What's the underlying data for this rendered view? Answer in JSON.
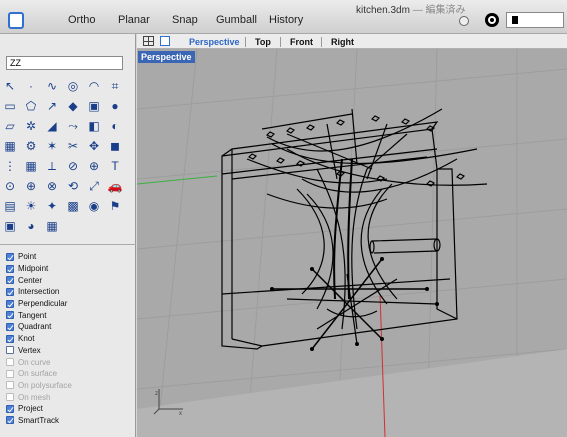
{
  "window": {
    "title": "kitchen.3dm",
    "title_sep": " — ",
    "title_status": "編集済み"
  },
  "toolbar": {
    "ortho": "Ortho",
    "planar": "Planar",
    "snap": "Snap",
    "gumball": "Gumball",
    "history": "History"
  },
  "command": {
    "value": "ZZ"
  },
  "tools": [
    "select-arrow-icon",
    "point-icon",
    "curve-icon",
    "circle-icon",
    "arc-icon",
    "surface-icon",
    "rectangle-icon",
    "polygon-icon",
    "interpolate-curve-icon",
    "extrude-icon",
    "box-icon",
    "sphere-icon",
    "freeform-icon",
    "fillet-icon",
    "chamfer-icon",
    "blend-icon",
    "boolean-icon",
    "cap-icon",
    "patch-icon",
    "gear-icon",
    "star-icon",
    "trim-icon",
    "move-icon",
    "solid-icon",
    "array-icon",
    "grid-icon",
    "ruler-icon",
    "split-icon",
    "join-icon",
    "text-icon",
    "snap-icon",
    "zoom-icon",
    "pan-icon",
    "rotate-icon",
    "scale-icon",
    "car-icon",
    "layer-icon",
    "render-icon",
    "light-icon",
    "material-icon",
    "color-icon",
    "settings-icon",
    "view-icon",
    "sphere-render-icon",
    "texture-icon"
  ],
  "snaps": [
    {
      "label": "Point",
      "checked": true,
      "enabled": true
    },
    {
      "label": "Midpoint",
      "checked": true,
      "enabled": true
    },
    {
      "label": "Center",
      "checked": true,
      "enabled": true
    },
    {
      "label": "Intersection",
      "checked": true,
      "enabled": true
    },
    {
      "label": "Perpendicular",
      "checked": true,
      "enabled": true
    },
    {
      "label": "Tangent",
      "checked": true,
      "enabled": true
    },
    {
      "label": "Quadrant",
      "checked": true,
      "enabled": true
    },
    {
      "label": "Knot",
      "checked": true,
      "enabled": true
    },
    {
      "label": "Vertex",
      "checked": false,
      "enabled": true
    },
    {
      "label": "On curve",
      "checked": false,
      "enabled": false
    },
    {
      "label": "On surface",
      "checked": false,
      "enabled": false
    },
    {
      "label": "On polysurface",
      "checked": false,
      "enabled": false
    },
    {
      "label": "On mesh",
      "checked": false,
      "enabled": false
    },
    {
      "label": "Project",
      "checked": true,
      "enabled": true
    },
    {
      "label": "SmartTrack",
      "checked": true,
      "enabled": true
    }
  ],
  "viewport_tabs": [
    {
      "label": "Perspective",
      "active": true
    },
    {
      "label": "Top",
      "active": false
    },
    {
      "label": "Front",
      "active": false
    },
    {
      "label": "Right",
      "active": false
    }
  ],
  "viewport": {
    "label": "Perspective",
    "background": "#a9a9a9",
    "axis_x_color": "#3cb043",
    "axis_y_color": "#d03030"
  },
  "colors": {
    "accent": "#2c66c6",
    "label_bg": "#3b66b5"
  }
}
